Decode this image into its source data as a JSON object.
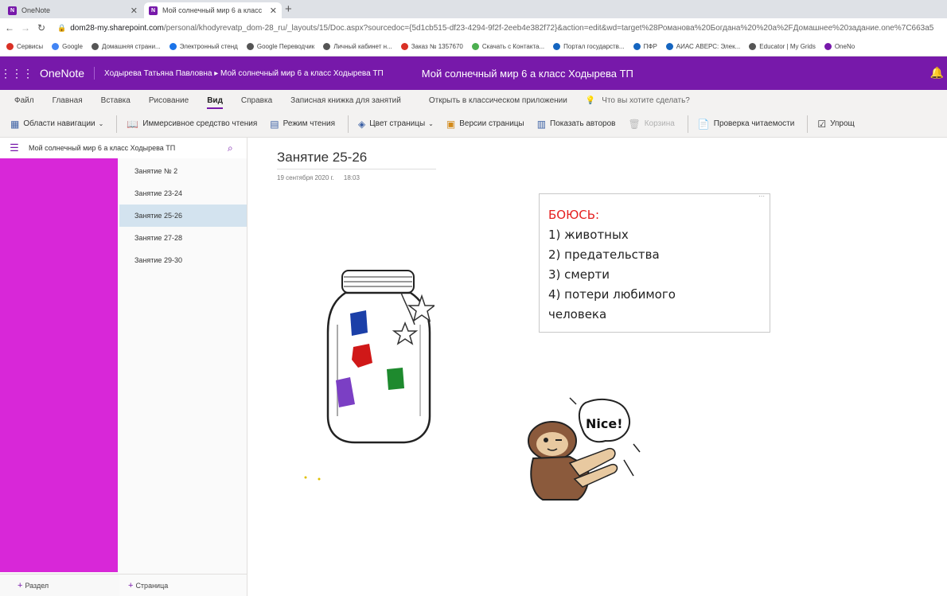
{
  "browser": {
    "tabs": [
      {
        "label": "OneNote",
        "icon": "onenote-icon"
      },
      {
        "label": "Мой солнечный мир 6 а класс",
        "icon": "onenote-icon"
      }
    ],
    "url_host": "dom28-my.sharepoint.com",
    "url_path": "/personal/khodyrevatp_dom-28_ru/_layouts/15/Doc.aspx?sourcedoc={5d1cb515-df23-4294-9f2f-2eeb4e382f72}&action=edit&wd=target%28Романова%20Богдана%20%20а%2FДомашнее%20задание.one%7C663a5",
    "bookmarks": [
      {
        "label": "Сервисы",
        "color": "#d93025"
      },
      {
        "label": "Google",
        "color": "#4285f4"
      },
      {
        "label": "Домашняя страни...",
        "color": "#555555"
      },
      {
        "label": "Электронный стенд",
        "color": "#1a73e8"
      },
      {
        "label": "Google Переводчик",
        "color": "#555555"
      },
      {
        "label": "Личный кабинет н...",
        "color": "#555555"
      },
      {
        "label": "Заказ № 1357670",
        "color": "#d93025"
      },
      {
        "label": "Скачать с Контакта...",
        "color": "#4caf50"
      },
      {
        "label": "Портал государств...",
        "color": "#1565c0"
      },
      {
        "label": "ПФР",
        "color": "#1565c0"
      },
      {
        "label": "АИАС АВЕРС: Элек...",
        "color": "#1565c0"
      },
      {
        "label": "Educator | My Grids",
        "color": "#555555"
      },
      {
        "label": "OneNo",
        "color": "#7719aa"
      }
    ]
  },
  "app": {
    "name": "OneNote",
    "breadcrumb": "Ходырева Татьяна Павловна ▸ Мой солнечный мир 6 а класс Ходырева ТП",
    "title": "Мой солнечный мир 6 а класс Ходырева ТП",
    "brand_color": "#7719aa"
  },
  "ribbon": {
    "tabs": [
      "Файл",
      "Главная",
      "Вставка",
      "Рисование",
      "Вид",
      "Справка",
      "Записная книжка для занятий"
    ],
    "active_tab": "Вид",
    "open_classic": "Открыть в классическом приложении",
    "search_placeholder": "Что вы хотите сделать?",
    "toolbar": {
      "nav_panes": "Области навигации",
      "immersive_reader": "Иммерсивное средство чтения",
      "reading_mode": "Режим чтения",
      "page_color": "Цвет страницы",
      "page_versions": "Версии страницы",
      "show_authors": "Показать авторов",
      "recycle_bin": "Корзина",
      "accessibility": "Проверка читаемости",
      "simplify": "Упрощ"
    }
  },
  "nav": {
    "notebook_name": "Мой солнечный мир 6 а класс Ходырева ТП",
    "section_color": "#d827d8",
    "pages": [
      {
        "label": "Занятие № 2",
        "active": false
      },
      {
        "label": "Занятие 23-24",
        "active": false
      },
      {
        "label": "Занятие 25-26",
        "active": true
      },
      {
        "label": "Занятие 27-28",
        "active": false
      },
      {
        "label": "Занятие 29-30",
        "active": false
      }
    ],
    "add_section": "Раздел",
    "add_page": "Страница"
  },
  "page": {
    "title": "Занятие 25-26",
    "date": "19 сентября 2020 г.",
    "time": "18:03",
    "note": {
      "heading": "БОЮСЬ:",
      "lines": [
        "1) животных",
        "2) предательства",
        "3) смерти",
        "4) потери любимого",
        "человека"
      ]
    },
    "sticker_text": "Nice!"
  }
}
